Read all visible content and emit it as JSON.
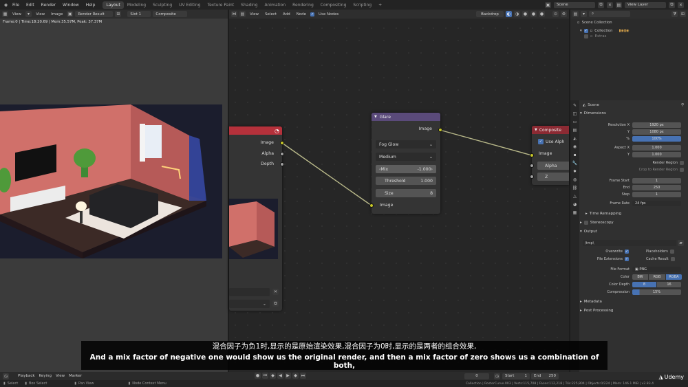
{
  "topbar": {
    "menus": [
      "File",
      "Edit",
      "Render",
      "Window",
      "Help"
    ],
    "workspaces": [
      "Layout",
      "Modeling",
      "Sculpting",
      "UV Editing",
      "Texture Paint",
      "Shading",
      "Animation",
      "Rendering",
      "Compositing",
      "Scripting"
    ],
    "active_workspace": "Layout",
    "add_tab": "+",
    "scene": "Scene",
    "view_layer": "View Layer"
  },
  "image_editor": {
    "header": {
      "view": "View",
      "image": "Image",
      "image_name": "Render Result",
      "slot": "Slot 1",
      "layer": "Composite"
    },
    "info": "Frame:0 | Time:18:20.69 | Mem:35.57M, Peak: 37.37M"
  },
  "node_editor": {
    "header": {
      "view": "View",
      "select": "Select",
      "add": "Add",
      "node": "Node",
      "use_nodes_label": "Use Nodes",
      "backdrop": "Backdrop"
    },
    "render_layers": {
      "outputs": [
        "Image",
        "Alpha",
        "Depth"
      ]
    },
    "glare": {
      "title": "Glare",
      "output": "Image",
      "glare_type": "Fog Glow",
      "quality": "Medium",
      "mix_label": "Mix",
      "mix_value": "-1.000",
      "threshold_label": "Threshold",
      "threshold_value": "1.000",
      "size_label": "Size",
      "size_value": "8",
      "input": "Image"
    },
    "composite": {
      "title": "Composite",
      "use_alpha": "Use Alph",
      "inputs": [
        "Image",
        "Alpha",
        "Z"
      ]
    }
  },
  "outliner": {
    "scene_collection": "Scene Collection",
    "collection": "Collection",
    "extras": "Extras"
  },
  "properties": {
    "scene_label": "Scene",
    "dimensions_header": "Dimensions",
    "rows": [
      {
        "label": "Resolution X",
        "value": "1920 px"
      },
      {
        "label": "Y",
        "value": "1080 px"
      },
      {
        "label": "%",
        "value": "100%",
        "blue": true
      },
      {
        "label": "Aspect X",
        "value": "1.000"
      },
      {
        "label": "Y",
        "value": "1.000"
      }
    ],
    "render_region": "Render Region",
    "crop_region": "Crop to Render Region",
    "frames": [
      {
        "label": "Frame Start",
        "value": "1"
      },
      {
        "label": "End",
        "value": "250"
      },
      {
        "label": "Step",
        "value": "1"
      }
    ],
    "frame_rate_label": "Frame Rate",
    "frame_rate_value": "24 fps",
    "time_remapping": "Time Remapping",
    "stereoscopy": "Stereoscopy",
    "output_header": "Output",
    "output_path": "/tmp\\",
    "overwrite": "Overwrite",
    "placeholders": "Placeholders",
    "file_extensions": "File Extensions",
    "cache_result": "Cache Result",
    "file_format_label": "File Format",
    "file_format_value": "PNG",
    "color_label": "Color",
    "color_options": [
      "BW",
      "RGB",
      "RGBA"
    ],
    "color_depth_label": "Color Depth",
    "color_depth_options": [
      "8",
      "16"
    ],
    "compression_label": "Compression",
    "compression_value": "15%",
    "metadata": "Metadata",
    "post_processing": "Post Processing"
  },
  "timeline": {
    "playback": "Playback",
    "keying": "Keying",
    "view": "View",
    "marker": "Marker",
    "current_frame": "0",
    "start_label": "Start",
    "start_value": "1",
    "end_label": "End",
    "end_value": "250"
  },
  "statusbar": {
    "select": "Select",
    "box_select": "Box Select",
    "pan_view": "Pan View",
    "node_context_menu": "Node Context Menu",
    "stats": "Collection | RosterCurve.003 | Verts:115,708 | Faces:112,218 | Tris:225,804 | Objects:0/224 | Mem: 146.1 MiB | v2.83.4",
    "watermark": "Udemy"
  },
  "subtitles": {
    "cn": "混合因子为负1时,显示的是原始渲染效果,混合因子为0时,显示的是两者的组合效果,",
    "en": "And a mix factor of negative one would show us the original render, and then a mix factor of zero shows us a combination of both,"
  },
  "colors": {
    "glare_header": "#5a4a7a",
    "composite_header": "#8c2a33",
    "render_layers_header": "#b5313b",
    "socket_yellow": "#c7c729",
    "accent_blue": "#4772b3"
  }
}
